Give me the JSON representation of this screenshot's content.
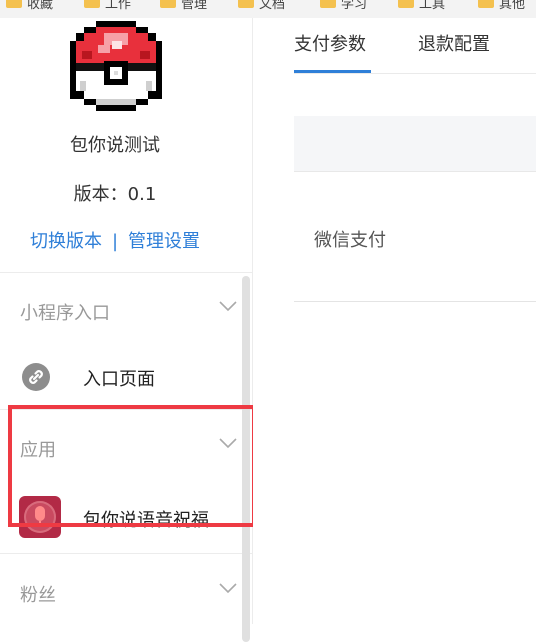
{
  "bookmarks": [
    "收藏",
    "工作",
    "管理",
    "文档",
    "学习",
    "工具",
    "其他"
  ],
  "sidebar": {
    "app_name": "包你说测试",
    "version": "版本：0.1",
    "switch_version": "切换版本",
    "separator": "|",
    "manage_settings": "管理设置",
    "sections": [
      {
        "title": "小程序入口",
        "item": "入口页面"
      },
      {
        "title": "应用",
        "item": "包你说语音祝福..."
      },
      {
        "title": "粉丝"
      }
    ]
  },
  "main": {
    "tabs": [
      "支付参数",
      "退款配置"
    ],
    "active_tab": 0,
    "rows": [
      "微信支付"
    ]
  },
  "colors": {
    "accent": "#2f7fd8",
    "highlight": "#ee3a43",
    "app_icon_bg": "#b22a46"
  },
  "icons": [
    "pokeball-logo",
    "link-icon",
    "microphone-icon",
    "chevron-down-icon",
    "folder-icon"
  ]
}
